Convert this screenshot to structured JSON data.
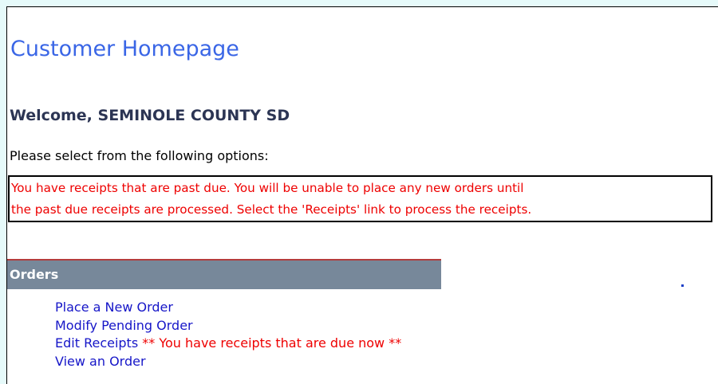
{
  "page": {
    "title": "Customer Homepage",
    "welcome": "Welcome, SEMINOLE COUNTY SD",
    "instructions": "Please select from the following options:"
  },
  "alert": {
    "line1": "You have receipts that are past due. You will be unable to place any new orders until",
    "line2": "the past due receipts are processed. Select the 'Receipts' link to process the receipts."
  },
  "orders": {
    "header": "Orders",
    "links": [
      {
        "label": "Place a New Order"
      },
      {
        "label": "Modify Pending Order"
      },
      {
        "label": "Edit Receipts",
        "note": " ** You have receipts that are due now **"
      },
      {
        "label": "View an Order"
      }
    ]
  },
  "colors": {
    "background": "#e6fafa",
    "title": "#3a66e6",
    "welcome": "#2c3554",
    "alert_text": "#ee0000",
    "section_header": "#77889a",
    "section_rule": "#b33c3c",
    "link": "#1616c8"
  }
}
